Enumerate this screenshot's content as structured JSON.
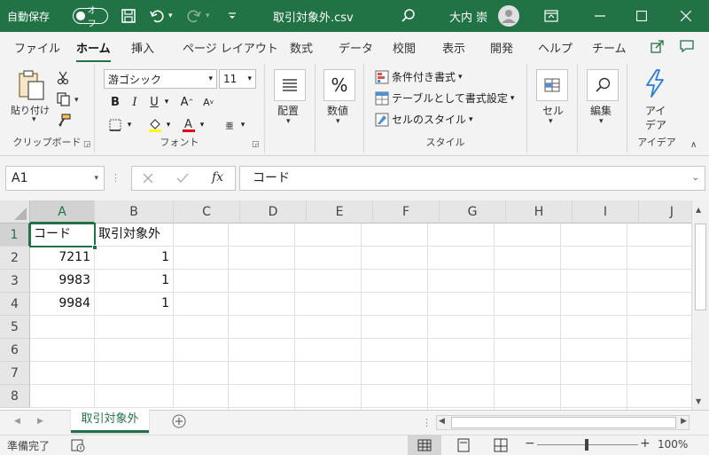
{
  "titlebar": {
    "autosave_label": "自動保存",
    "autosave_state": "オフ",
    "filename": "取引対象外.csv",
    "user_name": "大内 崇"
  },
  "tabs": [
    "ファイル",
    "ホーム",
    "挿入",
    "ページ レイアウト",
    "数式",
    "データ",
    "校閲",
    "表示",
    "開発",
    "ヘルプ",
    "チーム"
  ],
  "ribbon": {
    "clipboard": {
      "paste_label": "貼り付け",
      "group_label": "クリップボード"
    },
    "font": {
      "font_name": "游ゴシック",
      "font_size": "11",
      "group_label": "フォント"
    },
    "alignment": {
      "label": "配置"
    },
    "number": {
      "label": "数値"
    },
    "styles": {
      "conditional": "条件付き書式",
      "table": "テーブルとして書式設定",
      "cell_styles": "セルのスタイル",
      "group_label": "スタイル"
    },
    "cells": {
      "label": "セル"
    },
    "editing": {
      "label": "編集"
    },
    "ideas": {
      "label1": "アイ",
      "label2": "デア",
      "group_label": "アイデア"
    }
  },
  "formula_bar": {
    "name_box": "A1",
    "fx": "fx",
    "content": "コード"
  },
  "columns": [
    "A",
    "B",
    "C",
    "D",
    "E",
    "F",
    "G",
    "H",
    "I",
    "J"
  ],
  "rows": [
    "1",
    "2",
    "3",
    "4",
    "5",
    "6",
    "7",
    "8"
  ],
  "cells": {
    "r1": [
      "コード",
      "取引対象外"
    ],
    "r2": [
      "7211",
      "1"
    ],
    "r3": [
      "9983",
      "1"
    ],
    "r4": [
      "9984",
      "1"
    ]
  },
  "sheet_tab": "取引対象外",
  "status": {
    "ready": "準備完了",
    "zoom": "100%"
  },
  "colors": {
    "accent": "#217346"
  }
}
